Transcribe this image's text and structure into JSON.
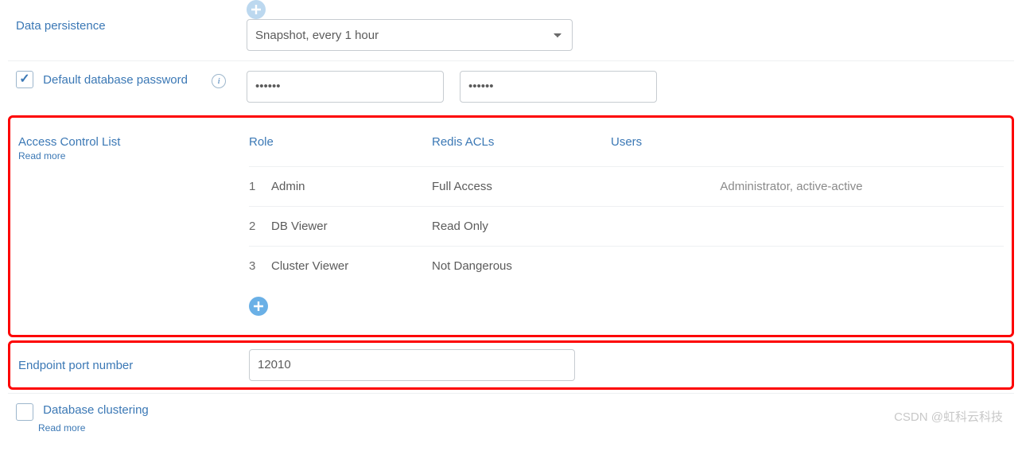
{
  "top_info_icon": "info-icon",
  "persistence": {
    "label": "Data persistence",
    "value": "Snapshot, every 1 hour"
  },
  "default_password": {
    "checked": true,
    "label": "Default database password",
    "info_icon": "info-icon",
    "password1": "••••••",
    "password2": "••••••"
  },
  "acl": {
    "title": "Access Control List",
    "read_more": "Read more",
    "headers": {
      "role": "Role",
      "redis": "Redis ACLs",
      "users": "Users"
    },
    "rows": [
      {
        "idx": "1",
        "role": "Admin",
        "redis": "Full Access",
        "users": "Administrator, active-active"
      },
      {
        "idx": "2",
        "role": "DB Viewer",
        "redis": "Read Only",
        "users": ""
      },
      {
        "idx": "3",
        "role": "Cluster Viewer",
        "redis": "Not Dangerous",
        "users": ""
      }
    ],
    "add_icon": "plus-icon"
  },
  "endpoint": {
    "label": "Endpoint port number",
    "value": "12010"
  },
  "clustering": {
    "checked": false,
    "label": "Database clustering",
    "read_more": "Read more"
  },
  "watermark": "CSDN @虹科云科技"
}
